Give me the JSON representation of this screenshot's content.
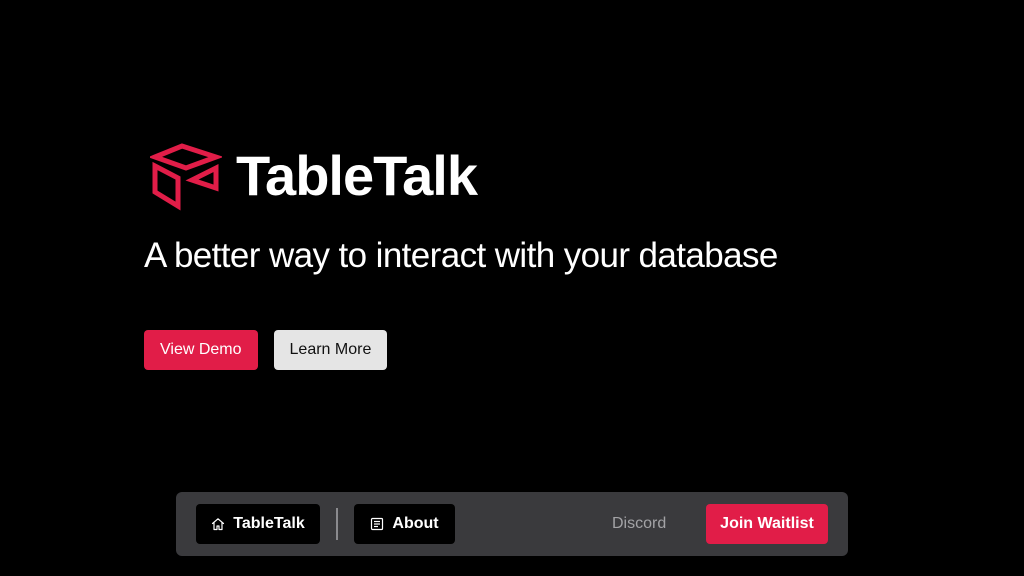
{
  "colors": {
    "background": "#000000",
    "accent": "#e11d48",
    "navbar": "#3a3a3d",
    "text": "#ffffff",
    "muted": "#a3a3a6"
  },
  "hero": {
    "logo_icon": "box-icon",
    "brand_name": "TableTalk",
    "tagline": "A better way to interact with your database",
    "buttons": {
      "view_demo": "View Demo",
      "learn_more": "Learn More"
    }
  },
  "navbar": {
    "home": {
      "label": "TableTalk",
      "icon": "home-icon"
    },
    "about": {
      "label": "About",
      "icon": "document-icon"
    },
    "discord": {
      "label": "Discord"
    },
    "join": {
      "label": "Join Waitlist"
    }
  }
}
